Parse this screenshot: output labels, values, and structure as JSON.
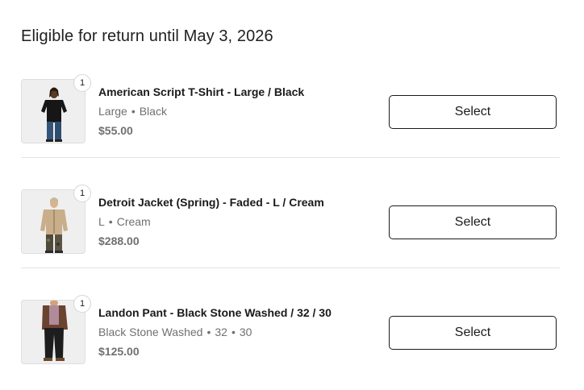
{
  "heading": "Eligible for return until May 3, 2026",
  "items": [
    {
      "quantity": "1",
      "title": "American Script T-Shirt - Large / Black",
      "variant_parts": [
        "Large",
        "Black"
      ],
      "separator": "•",
      "price": "$55.00",
      "button_label": "Select"
    },
    {
      "quantity": "1",
      "title": "Detroit Jacket (Spring) - Faded - L / Cream",
      "variant_parts": [
        "L",
        "Cream"
      ],
      "separator": "•",
      "price": "$288.00",
      "button_label": "Select"
    },
    {
      "quantity": "1",
      "title": "Landon Pant - Black Stone Washed / 32 / 30",
      "variant_parts": [
        "Black Stone Washed",
        "32",
        "30"
      ],
      "separator": "•",
      "price": "$125.00",
      "button_label": "Select"
    }
  ]
}
